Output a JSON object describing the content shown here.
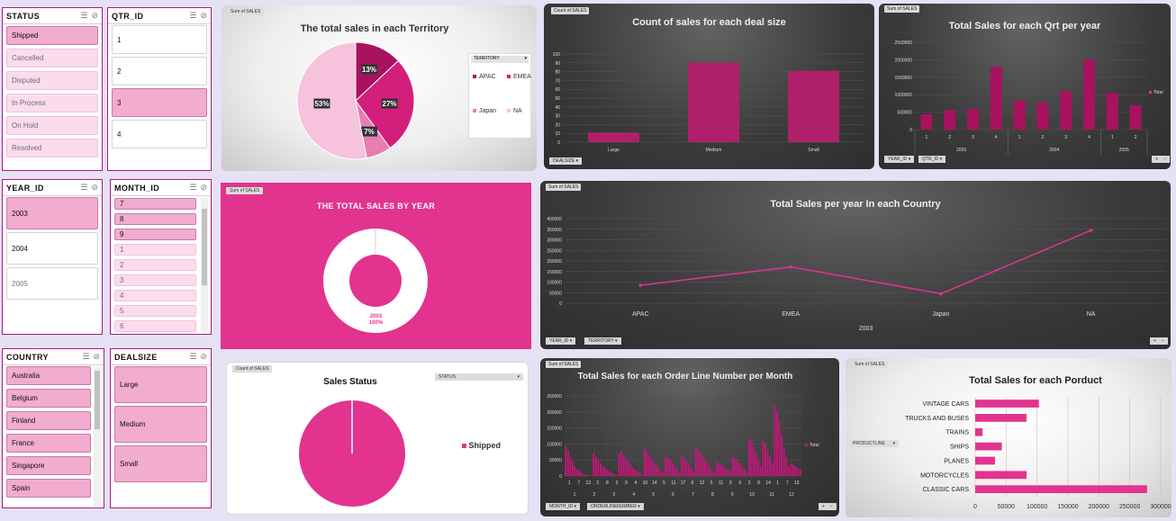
{
  "slicers": {
    "status": {
      "title": "STATUS",
      "items": [
        {
          "label": "Shipped",
          "selected": true
        },
        {
          "label": "Cancelled",
          "selected": false
        },
        {
          "label": "Disputed",
          "selected": false
        },
        {
          "label": "In Process",
          "selected": false
        },
        {
          "label": "On Hold",
          "selected": false
        },
        {
          "label": "Resolved",
          "selected": false
        }
      ]
    },
    "qtr": {
      "title": "QTR_ID",
      "items": [
        {
          "label": "1",
          "selected": false
        },
        {
          "label": "2",
          "selected": false
        },
        {
          "label": "3",
          "selected": true
        },
        {
          "label": "4",
          "selected": false
        }
      ]
    },
    "year": {
      "title": "YEAR_ID",
      "items": [
        {
          "label": "2003",
          "selected": true
        },
        {
          "label": "2004",
          "selected": false
        },
        {
          "label": "2005",
          "selected": false
        }
      ]
    },
    "month": {
      "title": "MONTH_ID",
      "items": [
        {
          "label": "7",
          "selected": true
        },
        {
          "label": "8",
          "selected": true
        },
        {
          "label": "9",
          "selected": true
        },
        {
          "label": "1",
          "selected": false
        },
        {
          "label": "2",
          "selected": false
        },
        {
          "label": "3",
          "selected": false
        },
        {
          "label": "4",
          "selected": false
        },
        {
          "label": "5",
          "selected": false
        },
        {
          "label": "6",
          "selected": false
        }
      ]
    },
    "country": {
      "title": "COUNTRY",
      "items": [
        {
          "label": "Australia",
          "selected": true
        },
        {
          "label": "Belgium",
          "selected": true
        },
        {
          "label": "Finland",
          "selected": true
        },
        {
          "label": "France",
          "selected": true
        },
        {
          "label": "Singapore",
          "selected": true
        },
        {
          "label": "Spain",
          "selected": true
        }
      ]
    },
    "dealsize": {
      "title": "DEALSIZE",
      "items": [
        {
          "label": "Large",
          "selected": true
        },
        {
          "label": "Medium",
          "selected": true
        },
        {
          "label": "Small",
          "selected": true
        }
      ]
    }
  },
  "fields": {
    "sum_sales": "Sum of SALES",
    "count_sales": "Count of SALES",
    "territory": "TERRITORY",
    "dealsize": "DEALSIZE",
    "year_id": "YEAR_ID",
    "qtr_id": "QTR_ID",
    "status": "STATUS",
    "month_id": "MONTH_ID",
    "orderline": "ORDERLINENUMBER",
    "productline": "PRODUCTLINE"
  },
  "colors": {
    "accent": "#e2338e",
    "dark_accent": "#a8125f",
    "light_pink": "#f2acd0"
  },
  "chart_data": [
    {
      "id": "territory_pie",
      "type": "pie",
      "title": "The total sales in each Territory",
      "legend_title": "TERRITORY",
      "categories": [
        "APAC",
        "EMEA",
        "Japan",
        "NA"
      ],
      "values": [
        13,
        27,
        7,
        53
      ],
      "labels": [
        "13%",
        "27%",
        "7%",
        "53%"
      ],
      "colors": [
        "#a8125f",
        "#d21f7c",
        "#e87db2",
        "#f6c2dc"
      ]
    },
    {
      "id": "dealsize_bar",
      "type": "bar",
      "title": "Count of sales for each deal size",
      "categories": [
        "Large",
        "Medium",
        "Small"
      ],
      "values": [
        11,
        90,
        81
      ],
      "yticks": [
        0,
        10,
        20,
        30,
        40,
        50,
        60,
        70,
        80,
        90,
        100
      ],
      "ylim": [
        0,
        100
      ]
    },
    {
      "id": "qtr_bar",
      "type": "bar",
      "title": "Total Sales for each Qrt per year",
      "legend": "Total",
      "groups": [
        {
          "year": "2003",
          "quarters": [
            "1",
            "2",
            "3",
            "4"
          ]
        },
        {
          "year": "2004",
          "quarters": [
            "1",
            "2",
            "3",
            "4"
          ]
        },
        {
          "year": "2005",
          "quarters": [
            "1",
            "2"
          ]
        }
      ],
      "values": [
        440000,
        560000,
        590000,
        1800000,
        830000,
        770000,
        1100000,
        2000000,
        1050000,
        700000
      ],
      "yticks": [
        "0",
        "500000",
        "1000000",
        "1500000",
        "2000000",
        "2500000"
      ],
      "ylim": [
        0,
        2500000
      ]
    },
    {
      "id": "year_donut",
      "type": "pie",
      "title": "THE TOTAL SALES BY YEAR",
      "categories": [
        "2003"
      ],
      "values": [
        100
      ],
      "label_year": "2003",
      "label_pct": "100%"
    },
    {
      "id": "country_line",
      "type": "line",
      "title": "Total Sales per year In each Country",
      "categories": [
        "APAC",
        "EMEA",
        "Japan",
        "NA"
      ],
      "values": [
        85000,
        172000,
        45000,
        345000
      ],
      "xgroup": "2003",
      "yticks": [
        "0",
        "50000",
        "100000",
        "150000",
        "200000",
        "250000",
        "300000",
        "350000",
        "400000"
      ],
      "ylim": [
        0,
        400000
      ]
    },
    {
      "id": "status_pie",
      "type": "pie",
      "title": "Sales Status",
      "categories": [
        "Shipped"
      ],
      "values": [
        100
      ],
      "legend": "Shipped",
      "legend_title": "STATUS"
    },
    {
      "id": "orderline_bar",
      "type": "bar",
      "title": "Total Sales for each Order Line Number per Month",
      "legend": "Total",
      "months": [
        "1",
        "2",
        "3",
        "4",
        "5",
        "6",
        "7",
        "8",
        "9",
        "10",
        "11",
        "12"
      ],
      "xlabels": [
        "1",
        "7",
        "13",
        "2",
        "8",
        "3",
        "9",
        "4",
        "10",
        "14",
        "5",
        "11",
        "17",
        "6",
        "12",
        "5",
        "11",
        "3",
        "9",
        "2",
        "8",
        "14",
        "1",
        "7",
        "13"
      ],
      "yticks": [
        "0",
        "50000",
        "100000",
        "150000",
        "200000",
        "250000"
      ],
      "ylim": [
        0,
        250000
      ],
      "values": [
        95000,
        80000,
        60000,
        45000,
        30000,
        20000,
        15000,
        10000,
        5000,
        3000,
        2000,
        1000,
        70000,
        60000,
        50000,
        40000,
        30000,
        25000,
        20000,
        15000,
        10000,
        5000,
        3000,
        70000,
        80000,
        65000,
        55000,
        45000,
        35000,
        25000,
        20000,
        15000,
        10000,
        5000,
        90000,
        75000,
        65000,
        55000,
        45000,
        35000,
        25000,
        15000,
        10000,
        60000,
        55000,
        50000,
        40000,
        30000,
        20000,
        10000,
        65000,
        55000,
        45000,
        35000,
        25000,
        15000,
        90000,
        80000,
        70000,
        60000,
        50000,
        40000,
        30000,
        20000,
        10000,
        45000,
        40000,
        35000,
        30000,
        25000,
        20000,
        15000,
        60000,
        55000,
        50000,
        40000,
        30000,
        20000,
        10000,
        120000,
        110000,
        90000,
        70000,
        50000,
        30000,
        110000,
        100000,
        80000,
        60000,
        40000,
        220000,
        200000,
        170000,
        130000,
        90000,
        60000,
        30000,
        40000,
        35000,
        30000,
        25000,
        20000
      ]
    },
    {
      "id": "product_bar",
      "type": "bar",
      "orientation": "horizontal",
      "title": "Total Sales for each Porduct",
      "categories": [
        "VINTAGE CARS",
        "TRUCKS AND BUSES",
        "TRAINS",
        "SHIPS",
        "PLANES",
        "MOTORCYCLES",
        "CLASSIC CARS"
      ],
      "values": [
        103000,
        83000,
        12000,
        43000,
        32000,
        83000,
        278000
      ],
      "xticks": [
        "0",
        "50000",
        "100000",
        "150000",
        "200000",
        "250000",
        "300000"
      ],
      "xlim": [
        0,
        300000
      ]
    }
  ]
}
